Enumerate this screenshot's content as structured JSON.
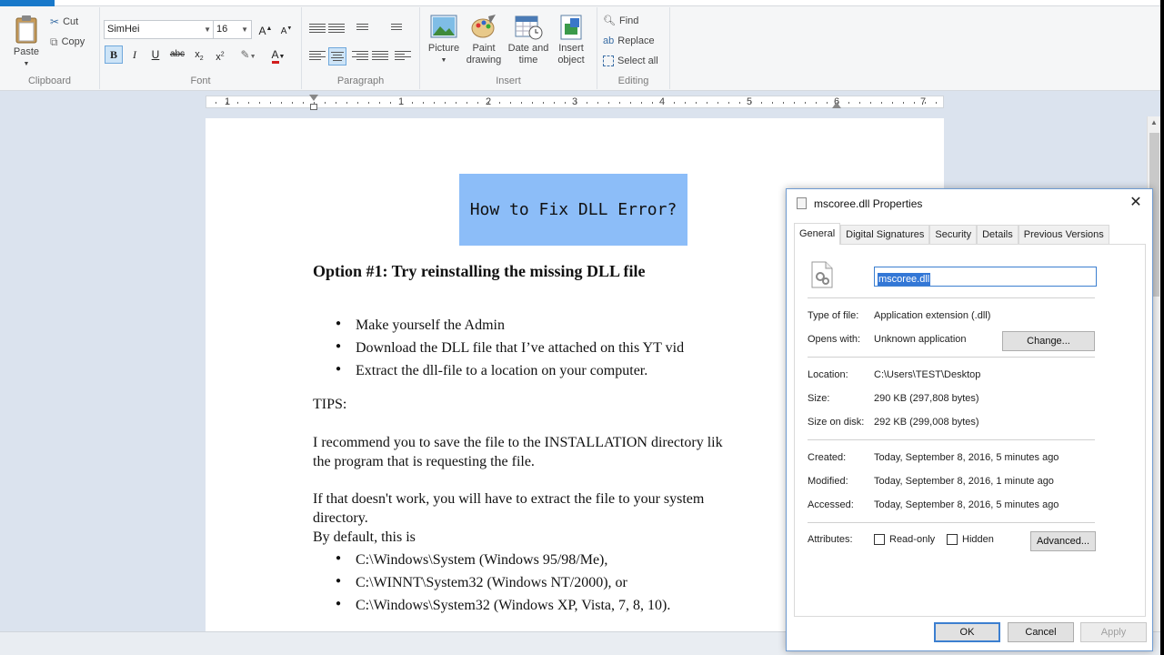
{
  "ribbon": {
    "clipboard": {
      "paste": "Paste",
      "cut": "Cut",
      "copy": "Copy",
      "label": "Clipboard"
    },
    "font": {
      "family": "SimHei",
      "size": "16",
      "label": "Font",
      "font_color": "#d11d1d"
    },
    "paragraph": {
      "label": "Paragraph"
    },
    "insert": {
      "picture": "Picture",
      "paint_drawing": [
        "Paint",
        "drawing"
      ],
      "date_time": [
        "Date and",
        "time"
      ],
      "insert_object": [
        "Insert",
        "object"
      ],
      "label": "Insert"
    },
    "editing": {
      "find": "Find",
      "replace": "Replace",
      "select_all": "Select all",
      "label": "Editing"
    }
  },
  "ruler": {
    "numbers": [
      "1",
      "1",
      "2",
      "3",
      "4",
      "5",
      "6",
      "7"
    ]
  },
  "document": {
    "title": "How to Fix DLL Error?",
    "heading": "Option #1: Try  reinstalling  the missing  DLL file",
    "bullets_1": [
      "Make yourself the Admin",
      "Download the DLL file that I’ve attached on this YT vid",
      "Extract the dll-file  to a location on your computer."
    ],
    "tips": "TIPS:",
    "para1_line1": "I recommend you to save the file to the INSTALLATION directory lik",
    "para1_line2": "the program that is requesting  the file.",
    "para2_line1": "If that doesn't work, you will have to extract the file  to your system",
    "para2_line2": "directory.",
    "para2_line3": "By default,  this is",
    "bullets_2": [
      "C:\\Windows\\System (Windows 95/98/Me),",
      "C:\\WINNT\\System32 (Windows NT/2000),  or",
      "C:\\Windows\\System32  (Windows XP, Vista, 7, 8, 10)."
    ]
  },
  "dialog": {
    "title": "mscoree.dll Properties",
    "close": "✕",
    "tabs": [
      "General",
      "Digital Signatures",
      "Security",
      "Details",
      "Previous Versions"
    ],
    "filename": "mscoree.dll",
    "type_label": "Type of file:",
    "type_value": "Application extension (.dll)",
    "opens_label": "Opens with:",
    "opens_value": "Unknown application",
    "change_button": "Change...",
    "location_label": "Location:",
    "location_value": "C:\\Users\\TEST\\Desktop",
    "size_label": "Size:",
    "size_value": "290 KB (297,808 bytes)",
    "size_disk_label": "Size on disk:",
    "size_disk_value": "292 KB (299,008 bytes)",
    "created_label": "Created:",
    "created_value": "Today, September 8, 2016, 5 minutes ago",
    "modified_label": "Modified:",
    "modified_value": "Today, September 8, 2016, 1 minute ago",
    "accessed_label": "Accessed:",
    "accessed_value": "Today, September 8, 2016, 5 minutes ago",
    "attributes_label": "Attributes:",
    "readonly_label": "Read-only",
    "hidden_label": "Hidden",
    "advanced_button": "Advanced...",
    "ok": "OK",
    "cancel": "Cancel",
    "apply": "Apply"
  }
}
